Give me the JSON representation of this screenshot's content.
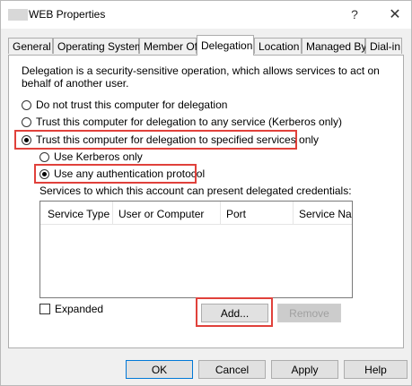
{
  "window": {
    "title": "WEB Properties",
    "help_glyph": "?",
    "close_glyph": "✕"
  },
  "tabs": [
    "General",
    "Operating System",
    "Member Of",
    "Delegation",
    "Location",
    "Managed By",
    "Dial-in"
  ],
  "active_tab": "Delegation",
  "delegation": {
    "description": "Delegation is a security-sensitive operation, which allows services to act on behalf of another user.",
    "options": {
      "no_trust": "Do not trust this computer for delegation",
      "any_service": "Trust this computer for delegation to any service (Kerberos only)",
      "specified": "Trust this computer for delegation to specified services only",
      "kerberos_only": "Use Kerberos only",
      "any_protocol": "Use any authentication protocol"
    },
    "selected": [
      "specified",
      "any_protocol"
    ],
    "services_label": "Services to which this account can present delegated credentials:",
    "columns": [
      "Service Type",
      "User or Computer",
      "Port",
      "Service Na"
    ],
    "rows": [],
    "expanded_label": "Expanded",
    "expanded_checked": false,
    "add_label": "Add...",
    "remove_label": "Remove"
  },
  "footer": {
    "ok": "OK",
    "cancel": "Cancel",
    "apply": "Apply",
    "help": "Help"
  },
  "colors": {
    "highlight": "#e0413b",
    "dialog_bg": "#f0f0f0"
  }
}
